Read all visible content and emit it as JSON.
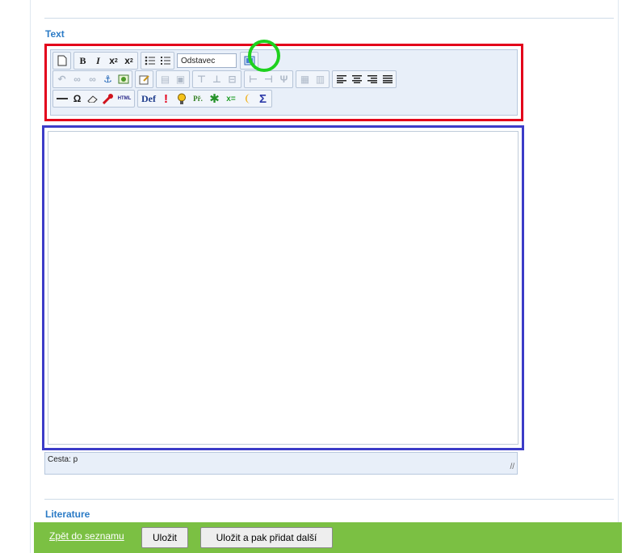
{
  "sections": {
    "text_label": "Text",
    "literature_label": "Literature"
  },
  "toolbar": {
    "format_select_value": "Odstavec",
    "row1_icons": [
      "new-document-icon",
      "bold-icon",
      "italic-icon",
      "subscript-icon",
      "superscript-icon",
      "unordered-list-icon",
      "ordered-list-icon"
    ],
    "row2_icons": [
      "undo-icon",
      "link-icon",
      "unlink-icon",
      "anchor-icon",
      "image-icon",
      "edit-icon",
      "table-icon",
      "table-props-icon",
      "row-before-icon",
      "row-after-icon",
      "delete-row-icon",
      "col-before-icon",
      "col-after-icon",
      "delete-col-icon",
      "split-cell-icon",
      "merge-cells-icon",
      "align-left-icon",
      "align-center-icon",
      "align-right-icon",
      "align-justify-icon"
    ],
    "row3_icons": [
      "horizontal-rule-icon",
      "omega-icon",
      "eraser-icon",
      "wrench-icon",
      "html-icon",
      "definition-icon",
      "exclamation-icon",
      "lightbulb-icon",
      "example-icon",
      "asterisk-icon",
      "equation-icon",
      "moon-icon",
      "sigma-icon"
    ],
    "labels": {
      "bold": "B",
      "italic": "I",
      "def": "Def",
      "pr": "Př.",
      "eq": "x=",
      "sigma": "Σ",
      "omega": "Ω",
      "html": "HTML",
      "excl": "!"
    }
  },
  "editor": {
    "path_text": "Cesta: p"
  },
  "footer": {
    "back_link": "Zpět do seznamu",
    "save_button": "Uložit",
    "save_add_button": "Uložit a pak přidat další"
  },
  "colors": {
    "highlight_red": "#e3001b",
    "highlight_blue": "#3c3cc8",
    "highlight_green": "#1ed11e",
    "footer": "#7bc043",
    "label_blue": "#2b7bc6"
  }
}
